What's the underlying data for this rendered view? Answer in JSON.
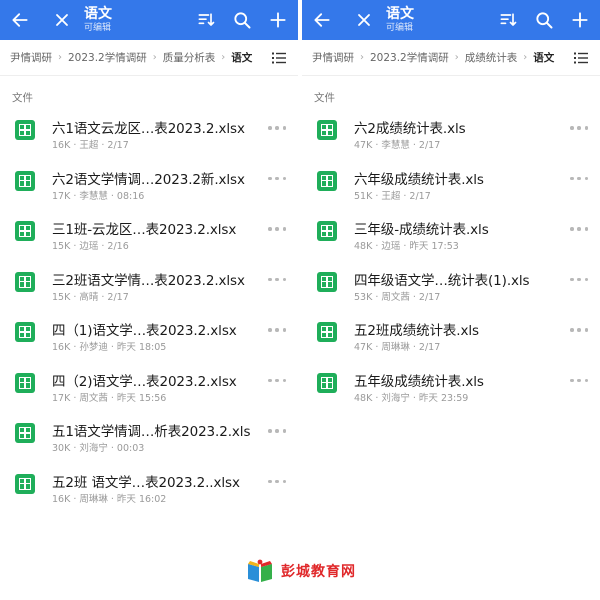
{
  "colors": {
    "accent": "#3478ea",
    "file_icon": "#1fae5a",
    "logo_text": "#e0282a"
  },
  "icons": {
    "back": "arrow-left-icon",
    "close": "close-icon",
    "sort": "sort-icon",
    "search": "search-icon",
    "add": "plus-icon",
    "view_toggle": "list-view-icon",
    "file_type": "spreadsheet-icon",
    "more": "more-horizontal-icon"
  },
  "left_pane": {
    "title": "语文",
    "subtitle": "可编辑",
    "breadcrumb": [
      "尹情调研",
      "2023.2学情调研",
      "质量分析表",
      "语文"
    ],
    "section_label": "文件",
    "files": [
      {
        "name": "六1语文云龙区…表2023.2.xlsx",
        "meta": "16K · 王超 · 2/17"
      },
      {
        "name": "六2语文学情调…2023.2新.xlsx",
        "meta": "17K · 李慧慧 · 08:16"
      },
      {
        "name": "三1班-云龙区…表2023.2.xlsx",
        "meta": "15K · 边瑶 · 2/16"
      },
      {
        "name": "三2班语文学情…表2023.2.xlsx",
        "meta": "15K · 高晴 · 2/17"
      },
      {
        "name": "四（1)语文学…表2023.2.xlsx",
        "meta": "16K · 孙梦迪 · 昨天 18:05"
      },
      {
        "name": "四（2)语文学…表2023.2.xlsx",
        "meta": "17K · 周文茜 · 昨天 15:56"
      },
      {
        "name": "五1语文学情调…析表2023.2.xls",
        "meta": "30K · 刘海宁 · 00:03"
      },
      {
        "name": "五2班 语文学…表2023.2..xlsx",
        "meta": "16K · 周琳琳 · 昨天 16:02"
      }
    ]
  },
  "right_pane": {
    "title": "语文",
    "subtitle": "可编辑",
    "breadcrumb": [
      "尹情调研",
      "2023.2学情调研",
      "成绩统计表",
      "语文"
    ],
    "section_label": "文件",
    "files": [
      {
        "name": "六2成绩统计表.xls",
        "meta": "47K · 李慧慧 · 2/17"
      },
      {
        "name": "六年级成绩统计表.xls",
        "meta": "51K · 王超 · 2/17"
      },
      {
        "name": "三年级-成绩统计表.xls",
        "meta": "48K · 边瑶 · 昨天 17:53"
      },
      {
        "name": "四年级语文学…统计表(1).xls",
        "meta": "53K · 周文茜 · 2/17"
      },
      {
        "name": "五2班成绩统计表.xls",
        "meta": "47K · 周琳琳 · 2/17"
      },
      {
        "name": "五年级成绩统计表.xls",
        "meta": "48K · 刘海宁 · 昨天 23:59"
      }
    ]
  },
  "watermark": {
    "text": "彭城教育网"
  }
}
